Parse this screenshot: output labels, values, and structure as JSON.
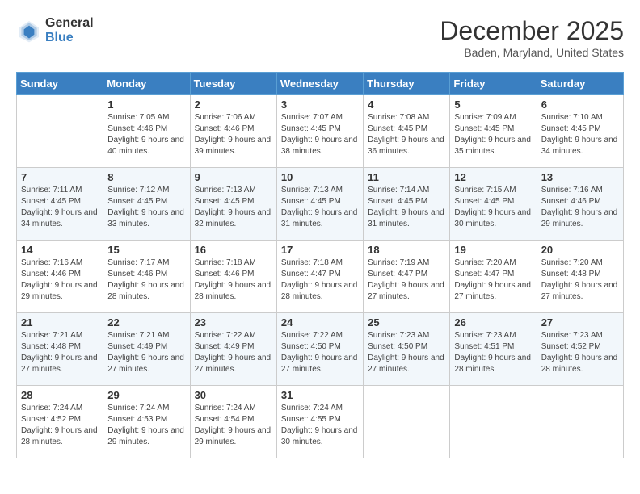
{
  "logo": {
    "general": "General",
    "blue": "Blue"
  },
  "title": "December 2025",
  "subtitle": "Baden, Maryland, United States",
  "days_of_week": [
    "Sunday",
    "Monday",
    "Tuesday",
    "Wednesday",
    "Thursday",
    "Friday",
    "Saturday"
  ],
  "weeks": [
    [
      {
        "day": "",
        "sunrise": "",
        "sunset": "",
        "daylight": ""
      },
      {
        "day": "1",
        "sunrise": "Sunrise: 7:05 AM",
        "sunset": "Sunset: 4:46 PM",
        "daylight": "Daylight: 9 hours and 40 minutes."
      },
      {
        "day": "2",
        "sunrise": "Sunrise: 7:06 AM",
        "sunset": "Sunset: 4:46 PM",
        "daylight": "Daylight: 9 hours and 39 minutes."
      },
      {
        "day": "3",
        "sunrise": "Sunrise: 7:07 AM",
        "sunset": "Sunset: 4:45 PM",
        "daylight": "Daylight: 9 hours and 38 minutes."
      },
      {
        "day": "4",
        "sunrise": "Sunrise: 7:08 AM",
        "sunset": "Sunset: 4:45 PM",
        "daylight": "Daylight: 9 hours and 36 minutes."
      },
      {
        "day": "5",
        "sunrise": "Sunrise: 7:09 AM",
        "sunset": "Sunset: 4:45 PM",
        "daylight": "Daylight: 9 hours and 35 minutes."
      },
      {
        "day": "6",
        "sunrise": "Sunrise: 7:10 AM",
        "sunset": "Sunset: 4:45 PM",
        "daylight": "Daylight: 9 hours and 34 minutes."
      }
    ],
    [
      {
        "day": "7",
        "sunrise": "Sunrise: 7:11 AM",
        "sunset": "Sunset: 4:45 PM",
        "daylight": "Daylight: 9 hours and 34 minutes."
      },
      {
        "day": "8",
        "sunrise": "Sunrise: 7:12 AM",
        "sunset": "Sunset: 4:45 PM",
        "daylight": "Daylight: 9 hours and 33 minutes."
      },
      {
        "day": "9",
        "sunrise": "Sunrise: 7:13 AM",
        "sunset": "Sunset: 4:45 PM",
        "daylight": "Daylight: 9 hours and 32 minutes."
      },
      {
        "day": "10",
        "sunrise": "Sunrise: 7:13 AM",
        "sunset": "Sunset: 4:45 PM",
        "daylight": "Daylight: 9 hours and 31 minutes."
      },
      {
        "day": "11",
        "sunrise": "Sunrise: 7:14 AM",
        "sunset": "Sunset: 4:45 PM",
        "daylight": "Daylight: 9 hours and 31 minutes."
      },
      {
        "day": "12",
        "sunrise": "Sunrise: 7:15 AM",
        "sunset": "Sunset: 4:45 PM",
        "daylight": "Daylight: 9 hours and 30 minutes."
      },
      {
        "day": "13",
        "sunrise": "Sunrise: 7:16 AM",
        "sunset": "Sunset: 4:46 PM",
        "daylight": "Daylight: 9 hours and 29 minutes."
      }
    ],
    [
      {
        "day": "14",
        "sunrise": "Sunrise: 7:16 AM",
        "sunset": "Sunset: 4:46 PM",
        "daylight": "Daylight: 9 hours and 29 minutes."
      },
      {
        "day": "15",
        "sunrise": "Sunrise: 7:17 AM",
        "sunset": "Sunset: 4:46 PM",
        "daylight": "Daylight: 9 hours and 28 minutes."
      },
      {
        "day": "16",
        "sunrise": "Sunrise: 7:18 AM",
        "sunset": "Sunset: 4:46 PM",
        "daylight": "Daylight: 9 hours and 28 minutes."
      },
      {
        "day": "17",
        "sunrise": "Sunrise: 7:18 AM",
        "sunset": "Sunset: 4:47 PM",
        "daylight": "Daylight: 9 hours and 28 minutes."
      },
      {
        "day": "18",
        "sunrise": "Sunrise: 7:19 AM",
        "sunset": "Sunset: 4:47 PM",
        "daylight": "Daylight: 9 hours and 27 minutes."
      },
      {
        "day": "19",
        "sunrise": "Sunrise: 7:20 AM",
        "sunset": "Sunset: 4:47 PM",
        "daylight": "Daylight: 9 hours and 27 minutes."
      },
      {
        "day": "20",
        "sunrise": "Sunrise: 7:20 AM",
        "sunset": "Sunset: 4:48 PM",
        "daylight": "Daylight: 9 hours and 27 minutes."
      }
    ],
    [
      {
        "day": "21",
        "sunrise": "Sunrise: 7:21 AM",
        "sunset": "Sunset: 4:48 PM",
        "daylight": "Daylight: 9 hours and 27 minutes."
      },
      {
        "day": "22",
        "sunrise": "Sunrise: 7:21 AM",
        "sunset": "Sunset: 4:49 PM",
        "daylight": "Daylight: 9 hours and 27 minutes."
      },
      {
        "day": "23",
        "sunrise": "Sunrise: 7:22 AM",
        "sunset": "Sunset: 4:49 PM",
        "daylight": "Daylight: 9 hours and 27 minutes."
      },
      {
        "day": "24",
        "sunrise": "Sunrise: 7:22 AM",
        "sunset": "Sunset: 4:50 PM",
        "daylight": "Daylight: 9 hours and 27 minutes."
      },
      {
        "day": "25",
        "sunrise": "Sunrise: 7:23 AM",
        "sunset": "Sunset: 4:50 PM",
        "daylight": "Daylight: 9 hours and 27 minutes."
      },
      {
        "day": "26",
        "sunrise": "Sunrise: 7:23 AM",
        "sunset": "Sunset: 4:51 PM",
        "daylight": "Daylight: 9 hours and 28 minutes."
      },
      {
        "day": "27",
        "sunrise": "Sunrise: 7:23 AM",
        "sunset": "Sunset: 4:52 PM",
        "daylight": "Daylight: 9 hours and 28 minutes."
      }
    ],
    [
      {
        "day": "28",
        "sunrise": "Sunrise: 7:24 AM",
        "sunset": "Sunset: 4:52 PM",
        "daylight": "Daylight: 9 hours and 28 minutes."
      },
      {
        "day": "29",
        "sunrise": "Sunrise: 7:24 AM",
        "sunset": "Sunset: 4:53 PM",
        "daylight": "Daylight: 9 hours and 29 minutes."
      },
      {
        "day": "30",
        "sunrise": "Sunrise: 7:24 AM",
        "sunset": "Sunset: 4:54 PM",
        "daylight": "Daylight: 9 hours and 29 minutes."
      },
      {
        "day": "31",
        "sunrise": "Sunrise: 7:24 AM",
        "sunset": "Sunset: 4:55 PM",
        "daylight": "Daylight: 9 hours and 30 minutes."
      },
      {
        "day": "",
        "sunrise": "",
        "sunset": "",
        "daylight": ""
      },
      {
        "day": "",
        "sunrise": "",
        "sunset": "",
        "daylight": ""
      },
      {
        "day": "",
        "sunrise": "",
        "sunset": "",
        "daylight": ""
      }
    ]
  ]
}
